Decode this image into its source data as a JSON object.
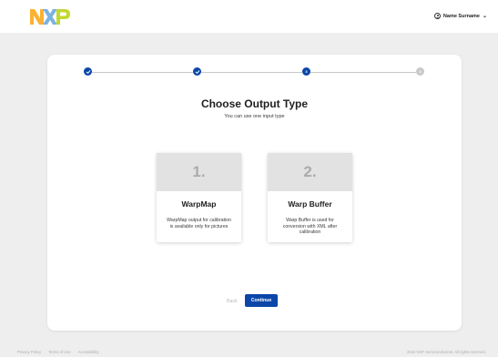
{
  "header": {
    "brand": "NXP",
    "user_name": "Name Surname"
  },
  "stepper": {
    "steps": [
      {
        "state": "done",
        "label": ""
      },
      {
        "state": "done",
        "label": ""
      },
      {
        "state": "current",
        "label": "3"
      },
      {
        "state": "todo",
        "label": "4"
      }
    ]
  },
  "main": {
    "title": "Choose Output Type",
    "subtitle": "You can use one input type",
    "options": [
      {
        "number": "1.",
        "name": "WarpMap",
        "description": "WarpMap output for calibration is available only for pictures"
      },
      {
        "number": "2.",
        "name": "Warp Buffer",
        "description": "Warp Buffer is used for conversion with XML after calibration"
      }
    ],
    "back_label": "Back",
    "continue_label": "Continue"
  },
  "footer": {
    "links": [
      "Privacy Policy",
      "Terms of Use",
      "Accessibility"
    ],
    "copyright": "2022 NXP Semiconductors. All rights reserved."
  },
  "colors": {
    "accent": "#0b46a8",
    "logo_orange": "#f9b233",
    "logo_blue": "#7bb2e0",
    "logo_green": "#c3d82e"
  }
}
